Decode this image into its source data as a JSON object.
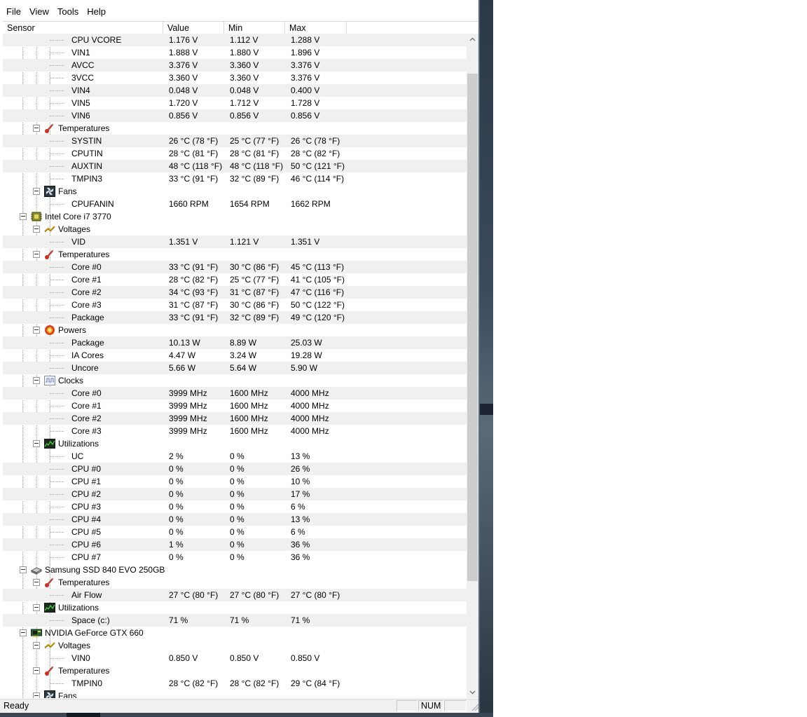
{
  "menu": [
    "File",
    "View",
    "Tools",
    "Help"
  ],
  "columns": {
    "sensor": "Sensor",
    "value": "Value",
    "min": "Min",
    "max": "Max"
  },
  "rows": [
    {
      "level": 2,
      "label": "CPU VCORE",
      "value": "1.176 V",
      "min": "1.112 V",
      "max": "1.288 V"
    },
    {
      "level": 2,
      "label": "VIN1",
      "value": "1.888 V",
      "min": "1.880 V",
      "max": "1.896 V"
    },
    {
      "level": 2,
      "label": "AVCC",
      "value": "3.376 V",
      "min": "3.360 V",
      "max": "3.376 V"
    },
    {
      "level": 2,
      "label": "3VCC",
      "value": "3.360 V",
      "min": "3.360 V",
      "max": "3.376 V"
    },
    {
      "level": 2,
      "label": "VIN4",
      "value": "0.048 V",
      "min": "0.048 V",
      "max": "0.400 V"
    },
    {
      "level": 2,
      "label": "VIN5",
      "value": "1.720 V",
      "min": "1.712 V",
      "max": "1.728 V"
    },
    {
      "level": 2,
      "label": "VIN6",
      "value": "0.856 V",
      "min": "0.856 V",
      "max": "0.856 V"
    },
    {
      "level": 1,
      "label": "Temperatures",
      "icon": "thermometer-icon"
    },
    {
      "level": 2,
      "label": "SYSTIN",
      "value": "26 °C  (78 °F)",
      "min": "25 °C  (77 °F)",
      "max": "26 °C  (78 °F)"
    },
    {
      "level": 2,
      "label": "CPUTIN",
      "value": "28 °C  (81 °F)",
      "min": "28 °C  (81 °F)",
      "max": "28 °C  (82 °F)"
    },
    {
      "level": 2,
      "label": "AUXTIN",
      "value": "48 °C  (118 °F)",
      "min": "48 °C  (118 °F)",
      "max": "50 °C  (121 °F)"
    },
    {
      "level": 2,
      "label": "TMPIN3",
      "value": "33 °C  (91 °F)",
      "min": "32 °C  (89 °F)",
      "max": "46 °C  (114 °F)"
    },
    {
      "level": 1,
      "label": "Fans",
      "icon": "fan-icon"
    },
    {
      "level": 2,
      "label": "CPUFANIN",
      "value": "1660 RPM",
      "min": "1654 RPM",
      "max": "1662 RPM"
    },
    {
      "level": 0,
      "label": "Intel Core i7 3770",
      "icon": "cpu-chip-icon"
    },
    {
      "level": 1,
      "label": "Voltages",
      "icon": "voltage-icon"
    },
    {
      "level": 2,
      "label": "VID",
      "value": "1.351 V",
      "min": "1.121 V",
      "max": "1.351 V"
    },
    {
      "level": 1,
      "label": "Temperatures",
      "icon": "thermometer-icon"
    },
    {
      "level": 2,
      "label": "Core #0",
      "value": "33 °C  (91 °F)",
      "min": "30 °C  (86 °F)",
      "max": "45 °C  (113 °F)"
    },
    {
      "level": 2,
      "label": "Core #1",
      "value": "28 °C  (82 °F)",
      "min": "25 °C  (77 °F)",
      "max": "41 °C  (105 °F)"
    },
    {
      "level": 2,
      "label": "Core #2",
      "value": "34 °C  (93 °F)",
      "min": "31 °C  (87 °F)",
      "max": "47 °C  (116 °F)"
    },
    {
      "level": 2,
      "label": "Core #3",
      "value": "31 °C  (87 °F)",
      "min": "30 °C  (86 °F)",
      "max": "50 °C  (122 °F)"
    },
    {
      "level": 2,
      "label": "Package",
      "value": "33 °C  (91 °F)",
      "min": "32 °C  (89 °F)",
      "max": "49 °C  (120 °F)"
    },
    {
      "level": 1,
      "label": "Powers",
      "icon": "power-icon"
    },
    {
      "level": 2,
      "label": "Package",
      "value": "10.13 W",
      "min": "8.89 W",
      "max": "25.03 W"
    },
    {
      "level": 2,
      "label": "IA Cores",
      "value": "4.47 W",
      "min": "3.24 W",
      "max": "19.28 W"
    },
    {
      "level": 2,
      "label": "Uncore",
      "value": "5.66 W",
      "min": "5.64 W",
      "max": "5.90 W"
    },
    {
      "level": 1,
      "label": "Clocks",
      "icon": "clock-wave-icon"
    },
    {
      "level": 2,
      "label": "Core #0",
      "value": "3999 MHz",
      "min": "1600 MHz",
      "max": "4000 MHz"
    },
    {
      "level": 2,
      "label": "Core #1",
      "value": "3999 MHz",
      "min": "1600 MHz",
      "max": "4000 MHz"
    },
    {
      "level": 2,
      "label": "Core #2",
      "value": "3999 MHz",
      "min": "1600 MHz",
      "max": "4000 MHz"
    },
    {
      "level": 2,
      "label": "Core #3",
      "value": "3999 MHz",
      "min": "1600 MHz",
      "max": "4000 MHz"
    },
    {
      "level": 1,
      "label": "Utilizations",
      "icon": "utilization-graph-icon"
    },
    {
      "level": 2,
      "label": "UC",
      "value": "2 %",
      "min": "0 %",
      "max": "13 %"
    },
    {
      "level": 2,
      "label": "CPU #0",
      "value": "0 %",
      "min": "0 %",
      "max": "26 %"
    },
    {
      "level": 2,
      "label": "CPU #1",
      "value": "0 %",
      "min": "0 %",
      "max": "10 %"
    },
    {
      "level": 2,
      "label": "CPU #2",
      "value": "0 %",
      "min": "0 %",
      "max": "17 %"
    },
    {
      "level": 2,
      "label": "CPU #3",
      "value": "0 %",
      "min": "0 %",
      "max": "6 %"
    },
    {
      "level": 2,
      "label": "CPU #4",
      "value": "0 %",
      "min": "0 %",
      "max": "13 %"
    },
    {
      "level": 2,
      "label": "CPU #5",
      "value": "0 %",
      "min": "0 %",
      "max": "6 %"
    },
    {
      "level": 2,
      "label": "CPU #6",
      "value": "1 %",
      "min": "0 %",
      "max": "36 %"
    },
    {
      "level": 2,
      "label": "CPU #7",
      "value": "0 %",
      "min": "0 %",
      "max": "36 %"
    },
    {
      "level": 0,
      "label": "Samsung SSD 840 EVO 250GB",
      "icon": "disk-drive-icon"
    },
    {
      "level": 1,
      "label": "Temperatures",
      "icon": "thermometer-icon"
    },
    {
      "level": 2,
      "label": "Air Flow",
      "value": "27 °C  (80 °F)",
      "min": "27 °C  (80 °F)",
      "max": "27 °C  (80 °F)"
    },
    {
      "level": 1,
      "label": "Utilizations",
      "icon": "utilization-graph-icon"
    },
    {
      "level": 2,
      "label": "Space (c:)",
      "value": "71 %",
      "min": "71 %",
      "max": "71 %"
    },
    {
      "level": 0,
      "label": "NVIDIA GeForce GTX 660",
      "icon": "gpu-card-icon"
    },
    {
      "level": 1,
      "label": "Voltages",
      "icon": "voltage-icon"
    },
    {
      "level": 2,
      "label": "VIN0",
      "value": "0.850 V",
      "min": "0.850 V",
      "max": "0.850 V"
    },
    {
      "level": 1,
      "label": "Temperatures",
      "icon": "thermometer-icon"
    },
    {
      "level": 2,
      "label": "TMPIN0",
      "value": "28 °C  (82 °F)",
      "min": "28 °C  (82 °F)",
      "max": "29 °C  (84 °F)"
    },
    {
      "level": 1,
      "label": "Fans",
      "icon": "fan-icon"
    }
  ],
  "status": {
    "text": "Ready",
    "num": "NUM"
  }
}
